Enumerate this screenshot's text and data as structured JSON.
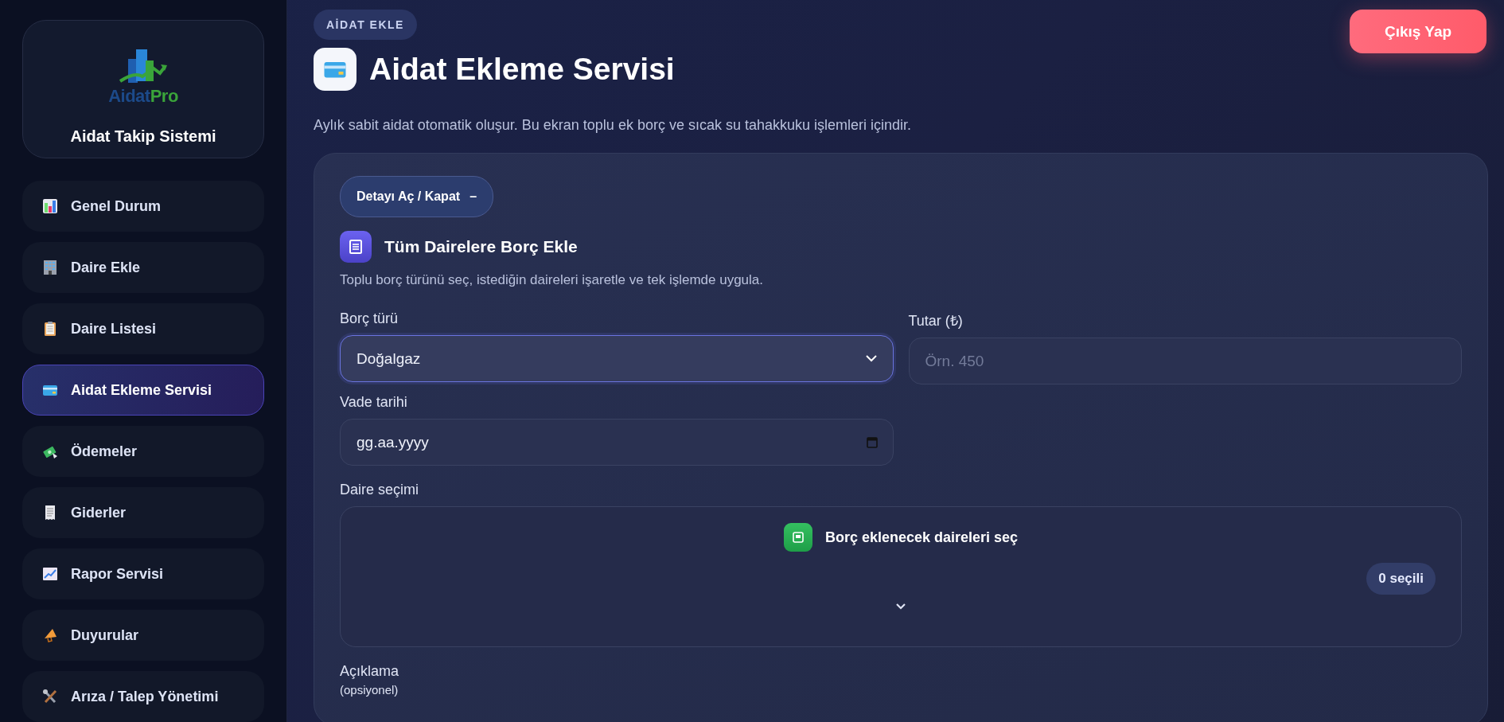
{
  "sidebar": {
    "logo": {
      "text_main": "Aidat",
      "text_accent": "Pro"
    },
    "title": "Aidat Takip Sistemi",
    "items": [
      {
        "label": "Genel Durum",
        "selected": false
      },
      {
        "label": "Daire Ekle",
        "selected": false
      },
      {
        "label": "Daire Listesi",
        "selected": false
      },
      {
        "label": "Aidat Ekleme Servisi",
        "selected": true
      },
      {
        "label": "Ödemeler",
        "selected": false
      },
      {
        "label": "Giderler",
        "selected": false
      },
      {
        "label": "Rapor Servisi",
        "selected": false
      },
      {
        "label": "Duyurular",
        "selected": false
      },
      {
        "label": "Arıza / Talep Yönetimi",
        "selected": false
      }
    ]
  },
  "header": {
    "badge": "AİDAT EKLE",
    "title": "Aidat Ekleme Servisi",
    "subtitle": "Aylık sabit aidat otomatik oluşur. Bu ekran toplu ek borç ve sıcak su tahakkuku işlemleri içindir.",
    "logout": "Çıkış Yap"
  },
  "panel": {
    "toggle": {
      "label": "Detayı Aç / Kapat",
      "symbol": "–"
    },
    "section_title": "Tüm Dairelere Borç Ekle",
    "section_desc": "Toplu borç türünü seç, istediğin daireleri işaretle ve tek işlemde uygula.",
    "debt_type": {
      "label": "Borç türü",
      "value": "Doğalgaz"
    },
    "amount": {
      "label": "Tutar (₺)",
      "placeholder": "Örn. 450"
    },
    "due_date": {
      "label": "Vade tarihi",
      "placeholder": "gg.aa.yyyy"
    },
    "apartments": {
      "label": "Daire seçimi",
      "button": "Borç eklenecek daireleri seç",
      "count": "0 seçili"
    },
    "description": {
      "label": "Açıklama",
      "hint": "(opsiyonel)"
    }
  }
}
